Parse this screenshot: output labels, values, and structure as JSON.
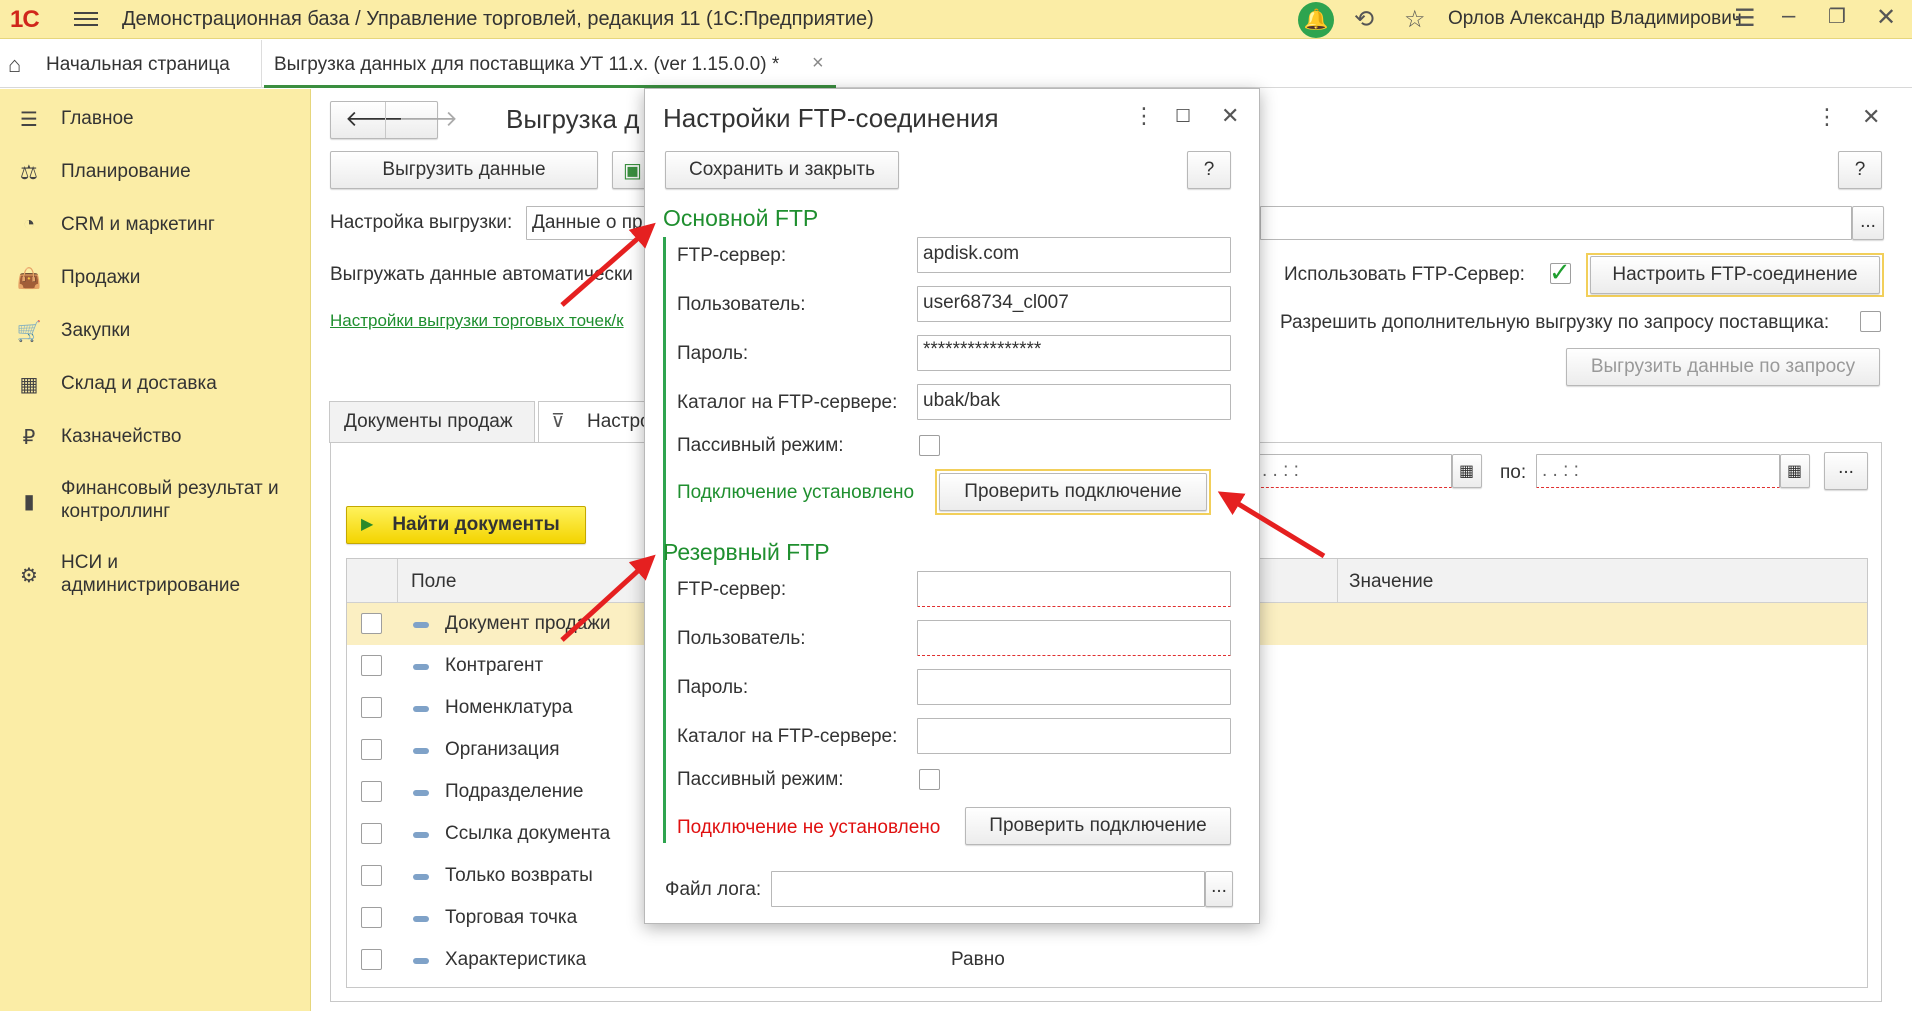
{
  "titlebar": {
    "logo": "1С",
    "title": "Демонстрационная база / Управление торговлей, редакция 11  (1С:Предприятие)",
    "user": "Орлов Александр Владимирович"
  },
  "tabs": {
    "home": "Начальная страница",
    "active": "Выгрузка данных для поставщика УТ 11.x. (ver 1.15.0.0) *"
  },
  "sidebar": {
    "items": [
      {
        "label": "Главное",
        "icon": "list-icon"
      },
      {
        "label": "Планирование",
        "icon": "planning-icon"
      },
      {
        "label": "CRM и маркетинг",
        "icon": "pie-chart-icon"
      },
      {
        "label": "Продажи",
        "icon": "shopping-bag-icon"
      },
      {
        "label": "Закупки",
        "icon": "cart-icon"
      },
      {
        "label": "Склад и доставка",
        "icon": "warehouse-icon"
      },
      {
        "label": "Казначейство",
        "icon": "ruble-icon"
      },
      {
        "label": "Финансовый результат и контроллинг",
        "icon": "bar-chart-icon"
      },
      {
        "label": "НСИ и администрирование",
        "icon": "gear-icon"
      }
    ]
  },
  "form": {
    "title": "Выгрузка д",
    "export_button": "Выгрузить данные",
    "settings_label": "Настройка выгрузки:",
    "settings_value": "Данные о пр",
    "auto_export_label": "Выгружать данные автоматически",
    "outlets_link": "Настройки выгрузки торговых точек/к",
    "use_ftp_label": "Использовать FTP-Сервер:",
    "configure_ftp_button": "Настроить FTP-соединение",
    "allow_extra_label": "Разрешить дополнительную выгрузку по запросу поставщика:",
    "export_on_request_button": "Выгрузить данные по запросу",
    "tab_sales": "Документы продаж",
    "tab_settings": "Настро",
    "date_from": ". .     :  :",
    "to_label": "по:",
    "date_to": " .  .     :  :",
    "more_button": "...",
    "help_button": "?",
    "find_button": "Найти документы",
    "col_field": "Поле",
    "col_value": "Значение",
    "rows": [
      {
        "field": "Документ продажи",
        "value": ""
      },
      {
        "field": "Контрагент",
        "value": ""
      },
      {
        "field": "Номенклатура",
        "value": ""
      },
      {
        "field": "Организация",
        "value": ""
      },
      {
        "field": "Подразделение",
        "value": ""
      },
      {
        "field": "Ссылка документа",
        "value": ""
      },
      {
        "field": "Только возвраты",
        "value": ""
      },
      {
        "field": "Торговая точка",
        "value": ""
      },
      {
        "field": "Характеристика",
        "value": "Равно"
      }
    ]
  },
  "dialog": {
    "title": "Настройки FTP-соединения",
    "save_close": "Сохранить и закрыть",
    "help": "?",
    "primary": {
      "title": "Основной FTP",
      "server_label": "FTP-сервер:",
      "server_value": "apdisk.com",
      "user_label": "Пользователь:",
      "user_value": "user68734_cl007",
      "password_label": "Пароль:",
      "password_value": "****************",
      "dir_label": "Каталог на FTP-сервере:",
      "dir_value": "ubak/bak",
      "passive_label": "Пассивный режим:",
      "status": "Подключение установлено",
      "check_button": "Проверить подключение"
    },
    "backup": {
      "title": "Резервный FTP",
      "server_label": "FTP-сервер:",
      "user_label": "Пользователь:",
      "password_label": "Пароль:",
      "dir_label": "Каталог на FTP-сервере:",
      "passive_label": "Пассивный режим:",
      "status": "Подключение не установлено",
      "check_button": "Проверить подключение"
    },
    "log_label": "Файл лога:",
    "log_button": "..."
  },
  "colors": {
    "sidebar_bg": "#fbeda6",
    "accent_green": "#1f8f2f",
    "error_red": "#e01010",
    "arrow_red": "#e52020"
  }
}
